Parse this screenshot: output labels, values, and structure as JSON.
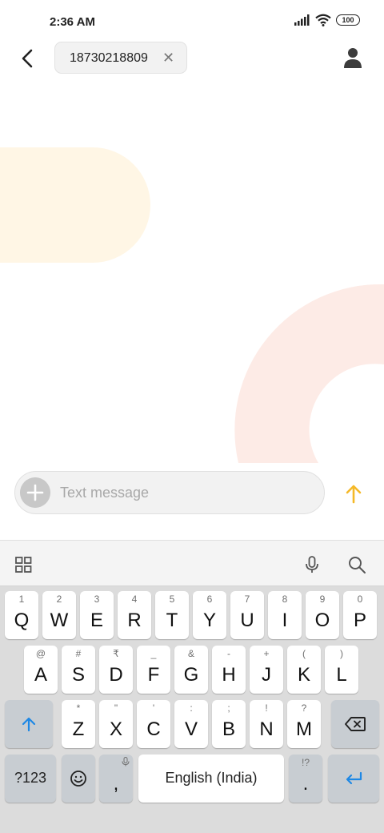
{
  "status_bar": {
    "time": "2:36 AM",
    "battery": "100",
    "icons": [
      "signal-icon",
      "wifi-icon",
      "battery-icon"
    ]
  },
  "header": {
    "recipient": "18730218809",
    "icons": [
      "back-arrow-icon",
      "close-icon",
      "contact-person-icon"
    ]
  },
  "compose": {
    "placeholder": "Text message",
    "icons": [
      "plus-icon",
      "send-arrow-icon"
    ],
    "send_color": "#f5b928"
  },
  "keyboard": {
    "toolbar_icons": [
      "grid-icon",
      "microphone-icon",
      "search-icon"
    ],
    "rows": [
      {
        "keys": [
          {
            "main": "Q",
            "hint": "1"
          },
          {
            "main": "W",
            "hint": "2"
          },
          {
            "main": "E",
            "hint": "3"
          },
          {
            "main": "R",
            "hint": "4"
          },
          {
            "main": "T",
            "hint": "5"
          },
          {
            "main": "Y",
            "hint": "6"
          },
          {
            "main": "U",
            "hint": "7"
          },
          {
            "main": "I",
            "hint": "8"
          },
          {
            "main": "O",
            "hint": "9"
          },
          {
            "main": "P",
            "hint": "0"
          }
        ]
      },
      {
        "keys": [
          {
            "main": "A",
            "hint": "@"
          },
          {
            "main": "S",
            "hint": "#"
          },
          {
            "main": "D",
            "hint": "₹"
          },
          {
            "main": "F",
            "hint": "_"
          },
          {
            "main": "G",
            "hint": "&"
          },
          {
            "main": "H",
            "hint": "-"
          },
          {
            "main": "J",
            "hint": "+"
          },
          {
            "main": "K",
            "hint": "("
          },
          {
            "main": "L",
            "hint": ")"
          }
        ]
      },
      {
        "keys": [
          {
            "main": "Z",
            "hint": "*"
          },
          {
            "main": "X",
            "hint": "\""
          },
          {
            "main": "C",
            "hint": "'"
          },
          {
            "main": "V",
            "hint": ":"
          },
          {
            "main": "B",
            "hint": ";"
          },
          {
            "main": "N",
            "hint": "!"
          },
          {
            "main": "M",
            "hint": "?"
          }
        ]
      }
    ],
    "symbols_key": "?123",
    "comma_key": ",",
    "space_label": "English (India)",
    "period_key": ".",
    "period_hint": "!?",
    "special_icons": [
      "shift-icon",
      "backspace-icon",
      "emoji-icon",
      "enter-icon"
    ],
    "accent_color": "#1e88e5"
  }
}
